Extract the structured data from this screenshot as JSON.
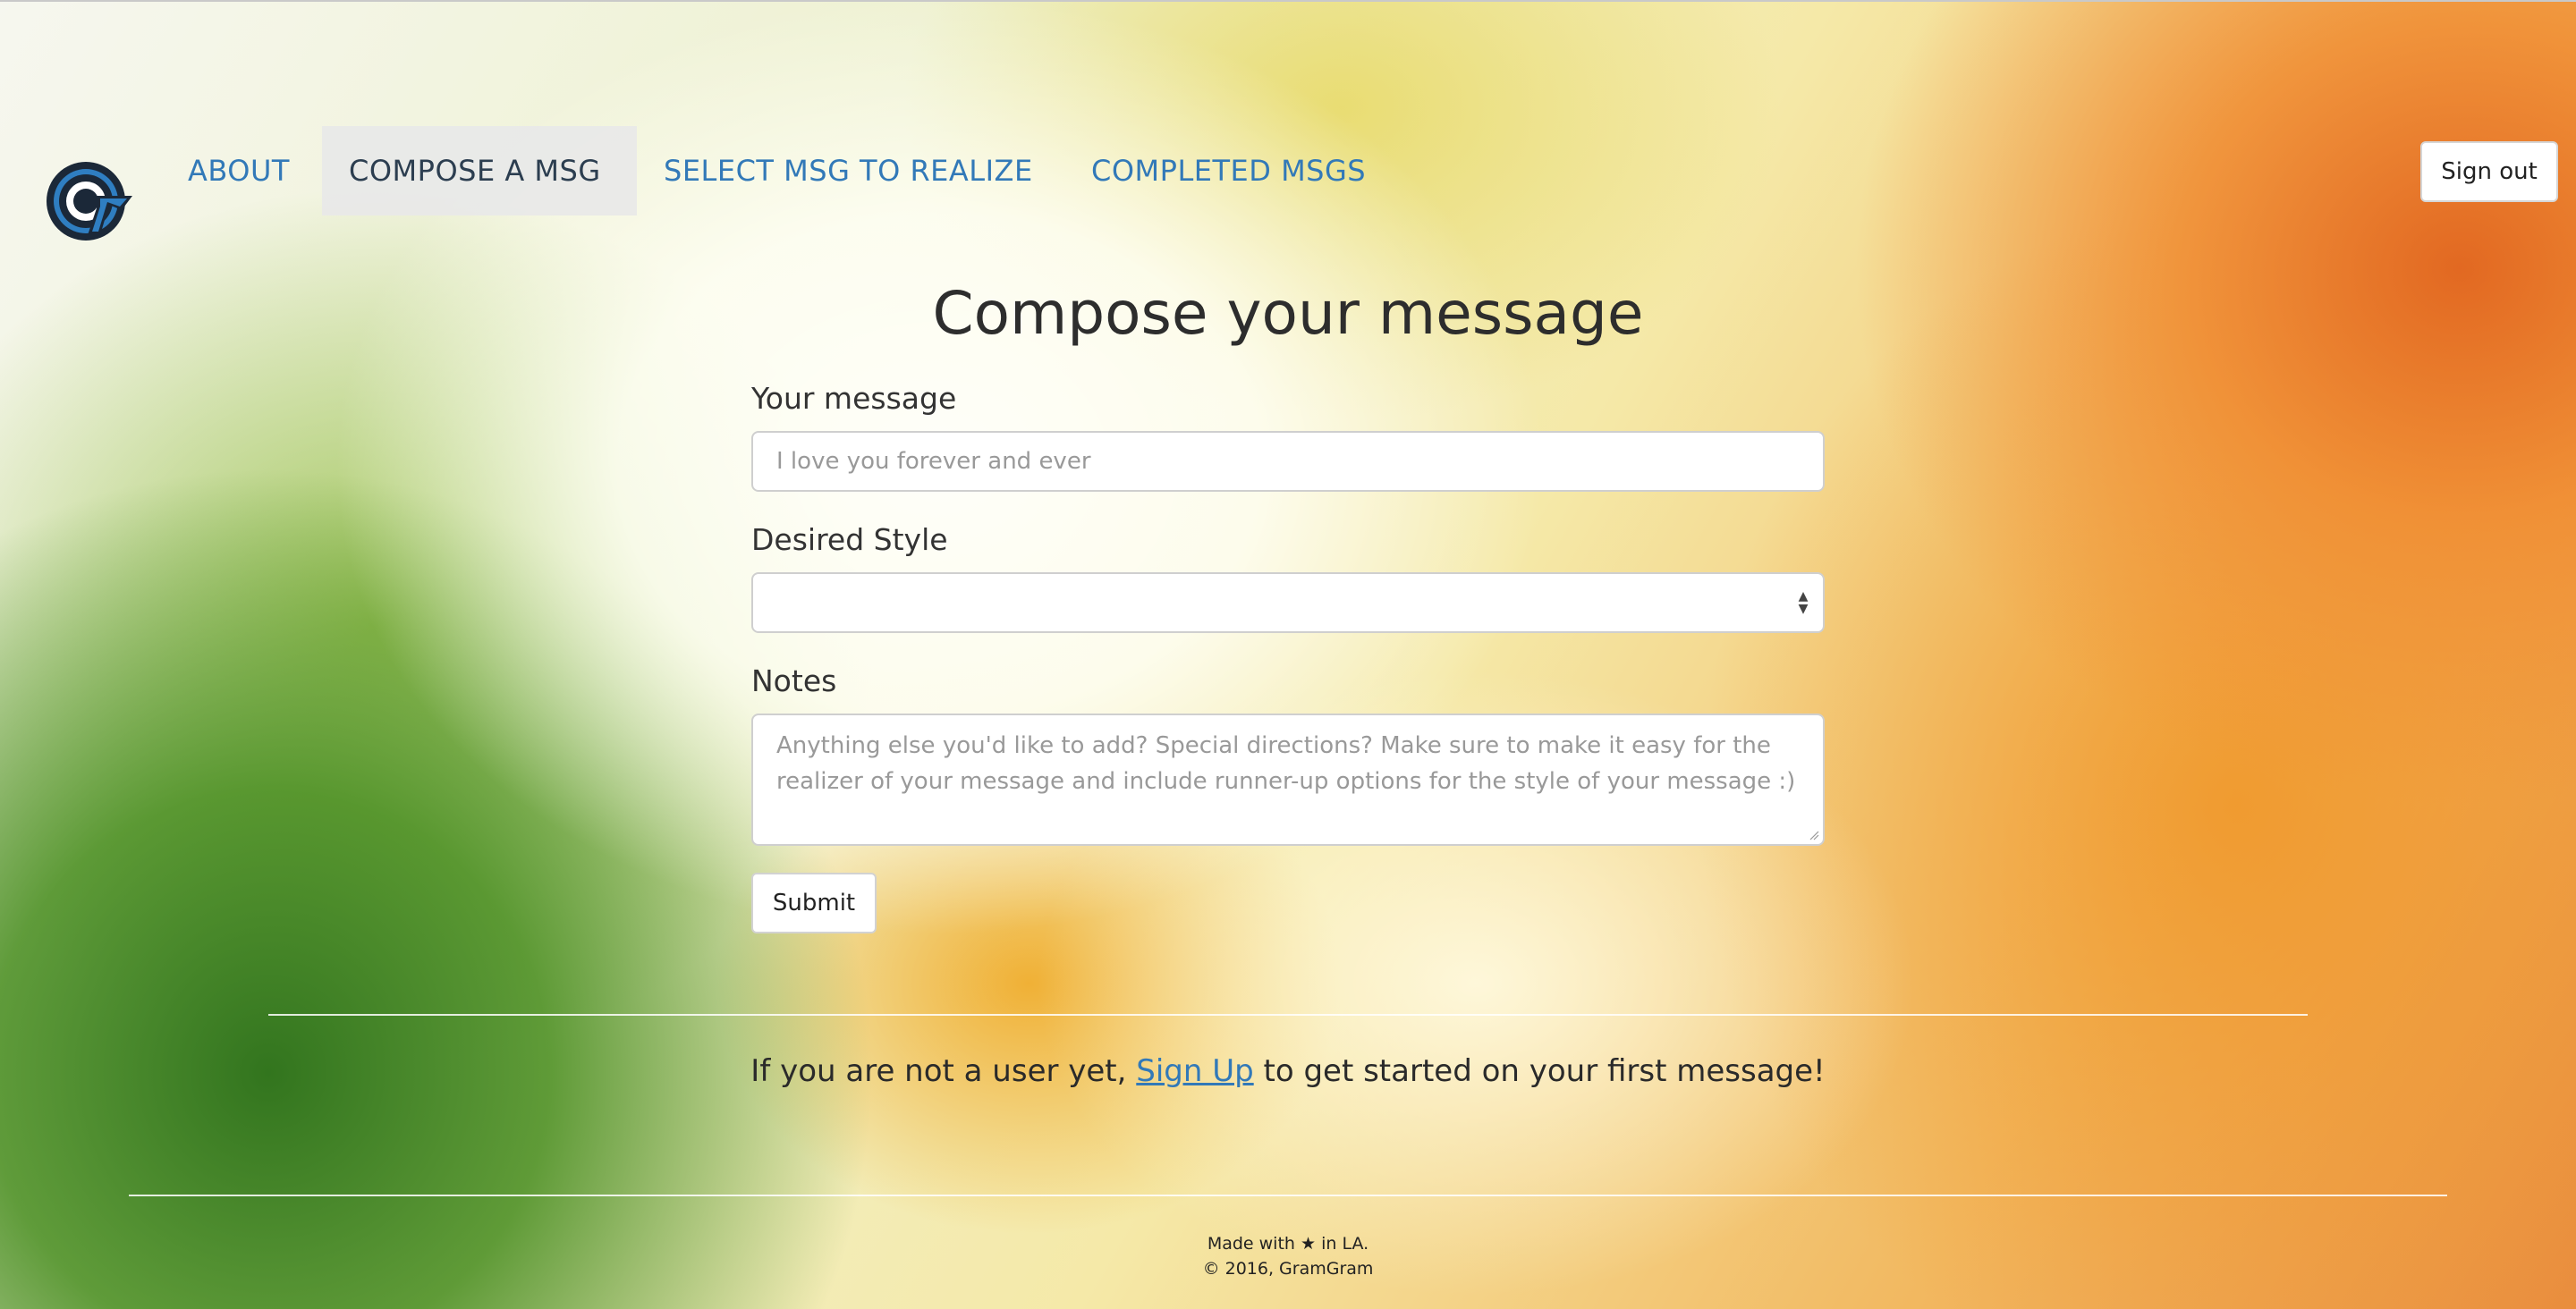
{
  "nav": {
    "items": [
      {
        "label": "ABOUT",
        "active": false
      },
      {
        "label": "COMPOSE A MSG",
        "active": true
      },
      {
        "label": "SELECT MSG TO REALIZE",
        "active": false
      },
      {
        "label": "COMPLETED MSGS",
        "active": false
      }
    ],
    "signout_label": "Sign out",
    "logo_icon": "gramgram-g-logo-icon"
  },
  "form": {
    "title": "Compose your message",
    "message_label": "Your message",
    "message_placeholder": "I love you forever and ever",
    "style_label": "Desired Style",
    "style_selected": "",
    "notes_label": "Notes",
    "notes_placeholder": "Anything else you'd like to add? Special directions?  Make sure to make it easy for the realizer of your message and include runner-up options for the style of your message :)",
    "submit_label": "Submit"
  },
  "signup": {
    "prefix": "If you are not a user yet, ",
    "link_text": "Sign Up",
    "suffix": " to get started on your first message!"
  },
  "footer": {
    "made_prefix": "Made with ",
    "made_icon": "star-icon",
    "made_suffix": " in LA.",
    "copyright": "© 2016, GramGram"
  },
  "colors": {
    "link": "#3279b8",
    "active_tab_bg": "#e8e8e8",
    "logo_blue": "#2f7ec1",
    "logo_dark": "#1b2838"
  }
}
